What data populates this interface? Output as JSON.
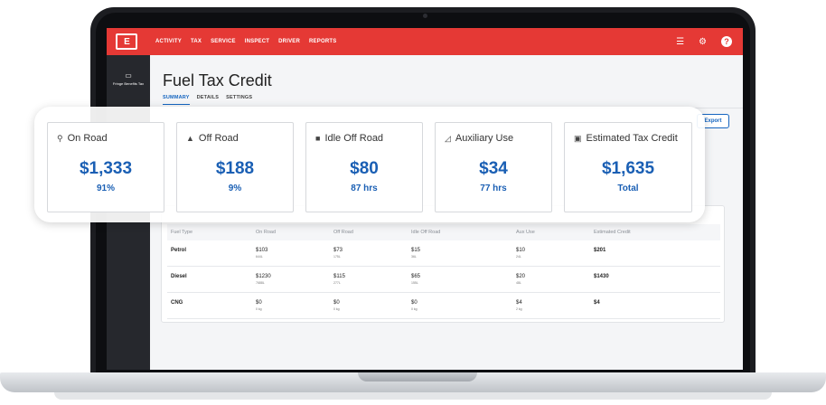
{
  "nav": {
    "logo": "E",
    "menu": [
      "ACTIVITY",
      "TAX",
      "SERVICE",
      "INSPECT",
      "DRIVER",
      "REPORTS"
    ],
    "icons": [
      "list-icon",
      "gear-icon",
      "help-icon"
    ],
    "help_glyph": "?"
  },
  "sidebar": {
    "item_label": "Fringe Benefits Tax"
  },
  "page": {
    "title": "Fuel Tax Credit",
    "tabs": [
      "SUMMARY",
      "DETAILS",
      "SETTINGS"
    ],
    "export_label": "Export"
  },
  "cards": [
    {
      "label": "On Road",
      "icon": "road-icon",
      "value": "$1,333",
      "sub": "91%"
    },
    {
      "label": "Off Road",
      "icon": "mountain-icon",
      "value": "$188",
      "sub": "9%"
    },
    {
      "label": "Idle Off Road",
      "icon": "truck-icon",
      "value": "$80",
      "sub": "87 hrs"
    },
    {
      "label": "Auxiliary Use",
      "icon": "crane-icon",
      "value": "$34",
      "sub": "77 hrs"
    },
    {
      "label": "Estimated Tax Credit",
      "icon": "clipboard-icon",
      "value": "$1,635",
      "sub": "Total"
    }
  ],
  "table": {
    "headers": [
      "Fuel Type",
      "On Road",
      "Off Road",
      "Idle Off Road",
      "Aux Use",
      "Estimated Credit"
    ],
    "rows": [
      {
        "fuel": "Petrol",
        "on_road": "$103",
        "on_road_q": "644L",
        "off_road": "$73",
        "off_road_q": "175L",
        "idle": "$15",
        "idle_q": "36L",
        "aux": "$10",
        "aux_q": "24L",
        "credit": "$201"
      },
      {
        "fuel": "Diesel",
        "on_road": "$1230",
        "on_road_q": "7688L",
        "off_road": "$115",
        "off_road_q": "277L",
        "idle": "$65",
        "idle_q": "155L",
        "aux": "$20",
        "aux_q": "48L",
        "credit": "$1430"
      },
      {
        "fuel": "CNG",
        "on_road": "$0",
        "on_road_q": "0 kg",
        "off_road": "$0",
        "off_road_q": "0 kg",
        "idle": "$0",
        "idle_q": "0 kg",
        "aux": "$4",
        "aux_q": "2 kg",
        "credit": "$4"
      }
    ]
  },
  "colors": {
    "brand_red": "#e53935",
    "accent_blue": "#1a5fb4",
    "sidebar_dark": "#26282d"
  }
}
